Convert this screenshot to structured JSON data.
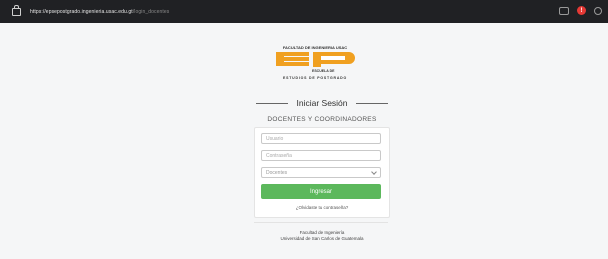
{
  "browser": {
    "url_main": "https://epsepostgrado.ingenieria.usac.edu.gt",
    "url_path": "/login_docentes",
    "extension_icon": "extension-icon",
    "alert_icon": "alert-icon",
    "alert_glyph": "!",
    "menu_icon": "profile-icon"
  },
  "logo": {
    "faculty_text": "FACULTAD DE INGENIERIA USAC",
    "school_text_line1": "ESCUELA DE",
    "studies_text": "ESTUDIOS DE POSTGRADO",
    "colors": {
      "orange": "#f0a020",
      "dark": "#333333"
    }
  },
  "login": {
    "title": "Iniciar Sesión",
    "subtitle": "DOCENTES Y COORDINADORES",
    "user_placeholder": "Usuario",
    "password_placeholder": "Contraseña",
    "role_selected": "Docentes",
    "submit_label": "Ingresar",
    "forgot_link": "¿Olvidaste tu contraseña?",
    "button_color": "#5cb85c"
  },
  "footer": {
    "line1": "Facultad de Ingeniería",
    "line2": "Universidad de San Carlos de Guatemala"
  }
}
